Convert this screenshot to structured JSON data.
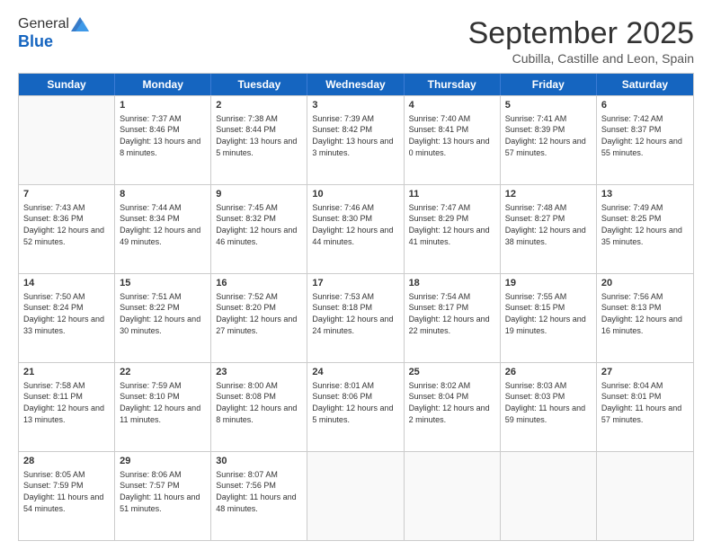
{
  "header": {
    "logo_line1": "General",
    "logo_line2": "Blue",
    "month_title": "September 2025",
    "subtitle": "Cubilla, Castille and Leon, Spain"
  },
  "days_of_week": [
    "Sunday",
    "Monday",
    "Tuesday",
    "Wednesday",
    "Thursday",
    "Friday",
    "Saturday"
  ],
  "weeks": [
    [
      {
        "day": "",
        "sunrise": "",
        "sunset": "",
        "daylight": ""
      },
      {
        "day": "1",
        "sunrise": "Sunrise: 7:37 AM",
        "sunset": "Sunset: 8:46 PM",
        "daylight": "Daylight: 13 hours and 8 minutes."
      },
      {
        "day": "2",
        "sunrise": "Sunrise: 7:38 AM",
        "sunset": "Sunset: 8:44 PM",
        "daylight": "Daylight: 13 hours and 5 minutes."
      },
      {
        "day": "3",
        "sunrise": "Sunrise: 7:39 AM",
        "sunset": "Sunset: 8:42 PM",
        "daylight": "Daylight: 13 hours and 3 minutes."
      },
      {
        "day": "4",
        "sunrise": "Sunrise: 7:40 AM",
        "sunset": "Sunset: 8:41 PM",
        "daylight": "Daylight: 13 hours and 0 minutes."
      },
      {
        "day": "5",
        "sunrise": "Sunrise: 7:41 AM",
        "sunset": "Sunset: 8:39 PM",
        "daylight": "Daylight: 12 hours and 57 minutes."
      },
      {
        "day": "6",
        "sunrise": "Sunrise: 7:42 AM",
        "sunset": "Sunset: 8:37 PM",
        "daylight": "Daylight: 12 hours and 55 minutes."
      }
    ],
    [
      {
        "day": "7",
        "sunrise": "Sunrise: 7:43 AM",
        "sunset": "Sunset: 8:36 PM",
        "daylight": "Daylight: 12 hours and 52 minutes."
      },
      {
        "day": "8",
        "sunrise": "Sunrise: 7:44 AM",
        "sunset": "Sunset: 8:34 PM",
        "daylight": "Daylight: 12 hours and 49 minutes."
      },
      {
        "day": "9",
        "sunrise": "Sunrise: 7:45 AM",
        "sunset": "Sunset: 8:32 PM",
        "daylight": "Daylight: 12 hours and 46 minutes."
      },
      {
        "day": "10",
        "sunrise": "Sunrise: 7:46 AM",
        "sunset": "Sunset: 8:30 PM",
        "daylight": "Daylight: 12 hours and 44 minutes."
      },
      {
        "day": "11",
        "sunrise": "Sunrise: 7:47 AM",
        "sunset": "Sunset: 8:29 PM",
        "daylight": "Daylight: 12 hours and 41 minutes."
      },
      {
        "day": "12",
        "sunrise": "Sunrise: 7:48 AM",
        "sunset": "Sunset: 8:27 PM",
        "daylight": "Daylight: 12 hours and 38 minutes."
      },
      {
        "day": "13",
        "sunrise": "Sunrise: 7:49 AM",
        "sunset": "Sunset: 8:25 PM",
        "daylight": "Daylight: 12 hours and 35 minutes."
      }
    ],
    [
      {
        "day": "14",
        "sunrise": "Sunrise: 7:50 AM",
        "sunset": "Sunset: 8:24 PM",
        "daylight": "Daylight: 12 hours and 33 minutes."
      },
      {
        "day": "15",
        "sunrise": "Sunrise: 7:51 AM",
        "sunset": "Sunset: 8:22 PM",
        "daylight": "Daylight: 12 hours and 30 minutes."
      },
      {
        "day": "16",
        "sunrise": "Sunrise: 7:52 AM",
        "sunset": "Sunset: 8:20 PM",
        "daylight": "Daylight: 12 hours and 27 minutes."
      },
      {
        "day": "17",
        "sunrise": "Sunrise: 7:53 AM",
        "sunset": "Sunset: 8:18 PM",
        "daylight": "Daylight: 12 hours and 24 minutes."
      },
      {
        "day": "18",
        "sunrise": "Sunrise: 7:54 AM",
        "sunset": "Sunset: 8:17 PM",
        "daylight": "Daylight: 12 hours and 22 minutes."
      },
      {
        "day": "19",
        "sunrise": "Sunrise: 7:55 AM",
        "sunset": "Sunset: 8:15 PM",
        "daylight": "Daylight: 12 hours and 19 minutes."
      },
      {
        "day": "20",
        "sunrise": "Sunrise: 7:56 AM",
        "sunset": "Sunset: 8:13 PM",
        "daylight": "Daylight: 12 hours and 16 minutes."
      }
    ],
    [
      {
        "day": "21",
        "sunrise": "Sunrise: 7:58 AM",
        "sunset": "Sunset: 8:11 PM",
        "daylight": "Daylight: 12 hours and 13 minutes."
      },
      {
        "day": "22",
        "sunrise": "Sunrise: 7:59 AM",
        "sunset": "Sunset: 8:10 PM",
        "daylight": "Daylight: 12 hours and 11 minutes."
      },
      {
        "day": "23",
        "sunrise": "Sunrise: 8:00 AM",
        "sunset": "Sunset: 8:08 PM",
        "daylight": "Daylight: 12 hours and 8 minutes."
      },
      {
        "day": "24",
        "sunrise": "Sunrise: 8:01 AM",
        "sunset": "Sunset: 8:06 PM",
        "daylight": "Daylight: 12 hours and 5 minutes."
      },
      {
        "day": "25",
        "sunrise": "Sunrise: 8:02 AM",
        "sunset": "Sunset: 8:04 PM",
        "daylight": "Daylight: 12 hours and 2 minutes."
      },
      {
        "day": "26",
        "sunrise": "Sunrise: 8:03 AM",
        "sunset": "Sunset: 8:03 PM",
        "daylight": "Daylight: 11 hours and 59 minutes."
      },
      {
        "day": "27",
        "sunrise": "Sunrise: 8:04 AM",
        "sunset": "Sunset: 8:01 PM",
        "daylight": "Daylight: 11 hours and 57 minutes."
      }
    ],
    [
      {
        "day": "28",
        "sunrise": "Sunrise: 8:05 AM",
        "sunset": "Sunset: 7:59 PM",
        "daylight": "Daylight: 11 hours and 54 minutes."
      },
      {
        "day": "29",
        "sunrise": "Sunrise: 8:06 AM",
        "sunset": "Sunset: 7:57 PM",
        "daylight": "Daylight: 11 hours and 51 minutes."
      },
      {
        "day": "30",
        "sunrise": "Sunrise: 8:07 AM",
        "sunset": "Sunset: 7:56 PM",
        "daylight": "Daylight: 11 hours and 48 minutes."
      },
      {
        "day": "",
        "sunrise": "",
        "sunset": "",
        "daylight": ""
      },
      {
        "day": "",
        "sunrise": "",
        "sunset": "",
        "daylight": ""
      },
      {
        "day": "",
        "sunrise": "",
        "sunset": "",
        "daylight": ""
      },
      {
        "day": "",
        "sunrise": "",
        "sunset": "",
        "daylight": ""
      }
    ]
  ]
}
